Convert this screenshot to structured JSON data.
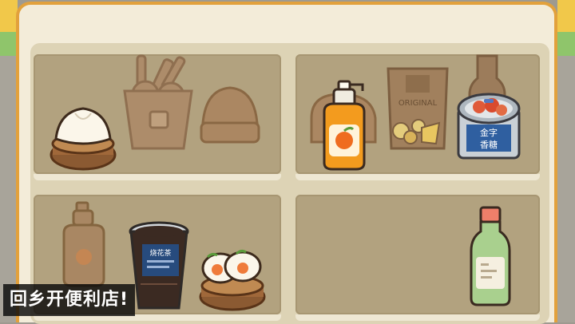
{
  "caption": "回乡开便利店!",
  "items": {
    "bread_can_label": "金字\n香糖",
    "snack_bag_label": "ORIGINAL",
    "cup_label": "烧花茶"
  },
  "colors": {
    "frame": "#e2a13c",
    "shelf": "#b2a27f",
    "shelf_highlight": "#eee7d3"
  }
}
